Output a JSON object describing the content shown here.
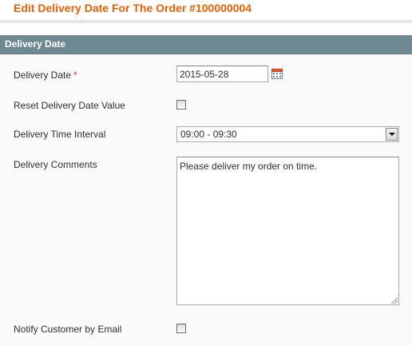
{
  "page": {
    "title": "Edit Delivery Date For The Order #100000004"
  },
  "section": {
    "header": "Delivery Date"
  },
  "form": {
    "delivery_date": {
      "label": "Delivery Date",
      "required_mark": "*",
      "value": "2015-05-28",
      "icon": "calendar-icon"
    },
    "reset_value": {
      "label": "Reset Delivery Date Value",
      "checked": false
    },
    "time_interval": {
      "label": "Delivery Time Interval",
      "selected": "09:00 - 09:30"
    },
    "comments": {
      "label": "Delivery Comments",
      "value": "Please deliver my order on time."
    },
    "notify_customer": {
      "label": "Notify Customer by Email",
      "checked": false
    }
  },
  "colors": {
    "title": "#eb5e00",
    "section_header_bg": "#6f8992",
    "required": "#eb340a"
  }
}
